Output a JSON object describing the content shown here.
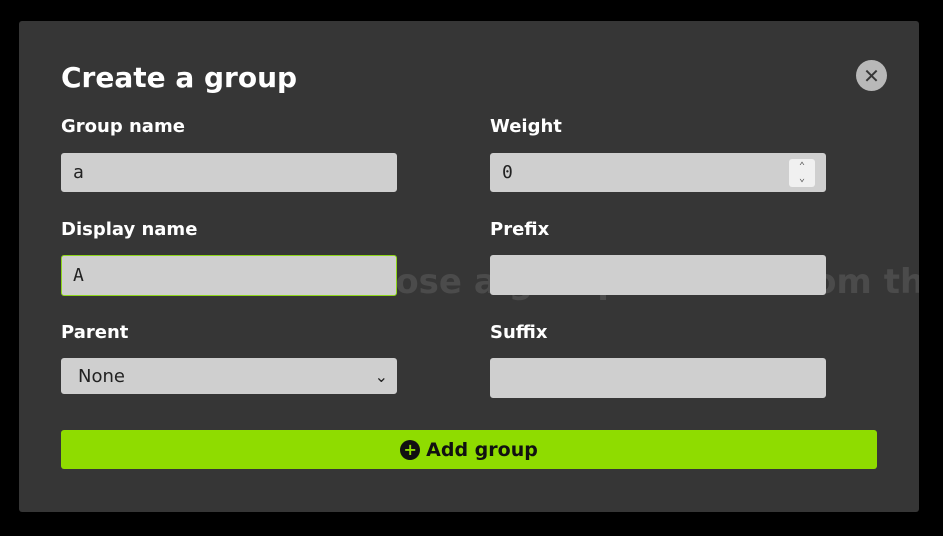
{
  "background_hint": "Choose a group or user from the s",
  "modal": {
    "title": "Create a group"
  },
  "form": {
    "group_name": {
      "label": "Group name",
      "value": "a"
    },
    "weight": {
      "label": "Weight",
      "value": "0"
    },
    "display_name": {
      "label": "Display name",
      "value": "A"
    },
    "prefix": {
      "label": "Prefix",
      "value": ""
    },
    "parent": {
      "label": "Parent",
      "selected": "None"
    },
    "suffix": {
      "label": "Suffix",
      "value": ""
    }
  },
  "actions": {
    "add_label": "Add group"
  },
  "colors": {
    "accent": "#8fdc00",
    "focus_border": "#8ed61b",
    "modal_bg": "#363636"
  },
  "icons": {
    "close": "close-icon",
    "add": "plus-circle-icon",
    "back": "arrow-left-icon",
    "select": "chevron-down-icon"
  }
}
